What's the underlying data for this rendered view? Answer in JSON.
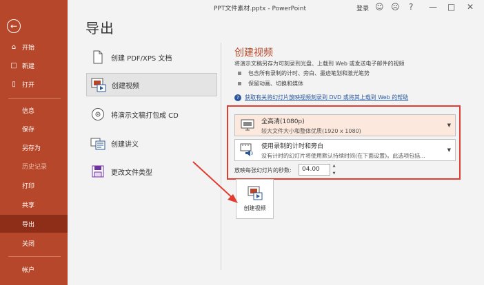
{
  "window": {
    "title": "PPT文件素材.pptx  -  PowerPoint",
    "login": "登录"
  },
  "sidebar": {
    "items": [
      {
        "label": "开始",
        "icon": "home-icon"
      },
      {
        "label": "新建",
        "icon": "new-file-icon"
      },
      {
        "label": "打开",
        "icon": "open-folder-icon"
      },
      {
        "label": "信息"
      },
      {
        "label": "保存"
      },
      {
        "label": "另存为"
      },
      {
        "label": "历史记录"
      },
      {
        "label": "打印"
      },
      {
        "label": "共享"
      },
      {
        "label": "导出"
      },
      {
        "label": "关闭"
      },
      {
        "label": "帐户"
      }
    ]
  },
  "page": {
    "title": "导出"
  },
  "options": [
    {
      "label": "创建 PDF/XPS 文档"
    },
    {
      "label": "创建视频"
    },
    {
      "label": "将演示文稿打包成 CD"
    },
    {
      "label": "创建讲义"
    },
    {
      "label": "更改文件类型"
    }
  ],
  "panel": {
    "title": "创建视频",
    "desc": "将演示文稿另存为可刻录到光盘、上载到 Web 或发送电子邮件的视频",
    "bullets": [
      "包含所有录制的计时、旁白、墨迹笔划和激光笔势",
      "保留动画、切换和媒体"
    ],
    "help": "获取有关将幻灯片放映视频刻录到 DVD 或将其上载到 Web 的帮助",
    "quality": {
      "title": "全高清(1080p)",
      "subtitle": "较大文件大小和整体优质(1920 x 1080)"
    },
    "timing": {
      "title": "使用录制的计时和旁白",
      "subtitle": "没有计时的幻灯片将使用默认持续时间(在下面设置)。此选项包括..."
    },
    "seconds_label": "放映每张幻灯片的秒数:",
    "seconds_value": "04.00",
    "create_button": "创建视频"
  }
}
